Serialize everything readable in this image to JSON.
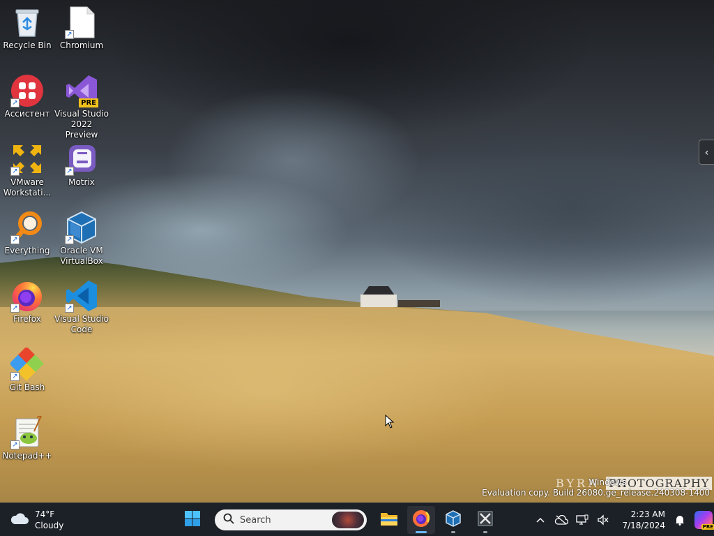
{
  "desktop": {
    "icons": [
      {
        "label": "Recycle Bin",
        "icon": "recycle-bin-icon"
      },
      {
        "label": "Chromium",
        "icon": "blank-file-icon"
      },
      {
        "label": "Ассистент",
        "icon": "assistant-icon"
      },
      {
        "label": "Visual Studio 2022 Preview",
        "icon": "visual-studio-icon",
        "badge": "PRE"
      },
      {
        "label": "VMware Workstati...",
        "icon": "vmware-icon"
      },
      {
        "label": "Motrix",
        "icon": "motrix-icon"
      },
      {
        "label": "Everything",
        "icon": "everything-search-icon"
      },
      {
        "label": "Oracle VM VirtualBox",
        "icon": "virtualbox-icon"
      },
      {
        "label": "Firefox",
        "icon": "firefox-icon"
      },
      {
        "label": "Visual Studio Code",
        "icon": "vscode-icon"
      },
      {
        "label": "Git Bash",
        "icon": "git-bash-icon"
      },
      {
        "label": "Notepad++",
        "icon": "notepad-plus-plus-icon"
      }
    ]
  },
  "wallpaper": {
    "watermark_left": "BYRN",
    "watermark_right": "PHOTOGRAPHY"
  },
  "system_info": {
    "line1": "Windows",
    "line2": "Evaluation copy. Build 26080.ge_release.240308-1400"
  },
  "side_handle": {
    "glyph": "‹"
  },
  "taskbar": {
    "weather": {
      "temp": "74°F",
      "condition": "Cloudy",
      "icon": "cloud-icon"
    },
    "search": {
      "placeholder": "Search"
    },
    "apps": [
      {
        "name": "start",
        "icon": "windows-start-icon"
      },
      {
        "name": "file-explorer",
        "icon": "folder-icon"
      },
      {
        "name": "firefox",
        "icon": "firefox-icon",
        "active": true
      },
      {
        "name": "virtualbox",
        "icon": "virtualbox-icon"
      },
      {
        "name": "tool",
        "icon": "tools-icon"
      }
    ],
    "tray": {
      "chevron": "^",
      "time": "2:23 AM",
      "date": "7/18/2024"
    }
  },
  "colors": {
    "taskbar_bg": "#1c2027",
    "accent": "#6cb8ff"
  }
}
